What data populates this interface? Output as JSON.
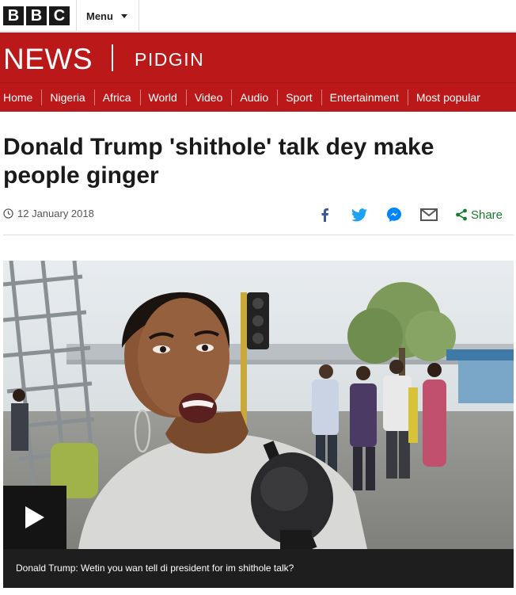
{
  "brand": {
    "logo_letters": [
      "B",
      "B",
      "C"
    ],
    "news": "NEWS",
    "edition": "PIDGIN"
  },
  "menu": {
    "label": "Menu"
  },
  "nav": {
    "items": [
      "Home",
      "Nigeria",
      "Africa",
      "World",
      "Video",
      "Audio",
      "Sport",
      "Entertainment",
      "Most popular"
    ]
  },
  "article": {
    "headline": "Donald Trump 'shithole' talk dey make people ginger",
    "date": "12 January 2018"
  },
  "share": {
    "label": "Share",
    "icons": [
      "facebook-icon",
      "twitter-icon",
      "messenger-icon",
      "email-icon",
      "share-icon"
    ]
  },
  "video": {
    "caption": "Donald Trump: Wetin you wan tell di president for im shithole talk?"
  },
  "colors": {
    "brand_red": "#bb1919",
    "share_green": "#1b7a2e",
    "facebook_blue": "#3b5998",
    "twitter_blue": "#1da1f2",
    "messenger_blue": "#0084ff"
  }
}
